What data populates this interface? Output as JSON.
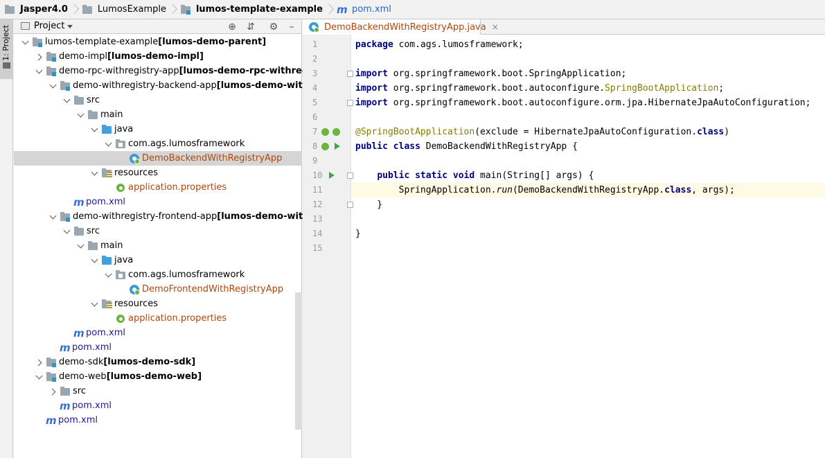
{
  "breadcrumb": [
    {
      "label": "Jasper4.0",
      "bold": true,
      "icon": "folder-icon"
    },
    {
      "label": "LumosExample",
      "bold": false,
      "icon": "folder-icon"
    },
    {
      "label": "lumos-template-example",
      "bold": true,
      "icon": "module-folder-icon"
    },
    {
      "label": "pom.xml",
      "bold": false,
      "icon": "maven-icon"
    }
  ],
  "side_strip": {
    "tab_label": "1: Project"
  },
  "project_panel": {
    "title": "Project",
    "tree": [
      {
        "depth": 0,
        "arrow": "down",
        "icon": "module",
        "name": "lumos-template-example",
        "suffix": " [lumos-demo-parent]"
      },
      {
        "depth": 1,
        "arrow": "right",
        "icon": "module",
        "name": "demo-impl",
        "suffix": " [lumos-demo-impl]"
      },
      {
        "depth": 1,
        "arrow": "down",
        "icon": "module",
        "name": "demo-rpc-withregistry-app",
        "suffix": " [lumos-demo-rpc-withregistry-"
      },
      {
        "depth": 2,
        "arrow": "down",
        "icon": "module",
        "name": "demo-withregistry-backend-app",
        "suffix": " [lumos-demo-withregi"
      },
      {
        "depth": 3,
        "arrow": "down",
        "icon": "folder",
        "name": "src",
        "suffix": ""
      },
      {
        "depth": 4,
        "arrow": "down",
        "icon": "folder",
        "name": "main",
        "suffix": ""
      },
      {
        "depth": 5,
        "arrow": "down",
        "icon": "java",
        "name": "java",
        "suffix": ""
      },
      {
        "depth": 6,
        "arrow": "down",
        "icon": "package",
        "name": "com.ags.lumosframework",
        "suffix": ""
      },
      {
        "depth": 7,
        "arrow": "none",
        "icon": "class",
        "name": "DemoBackendWithRegistryApp",
        "suffix": "",
        "selected": true
      },
      {
        "depth": 5,
        "arrow": "down",
        "icon": "resources",
        "name": "resources",
        "suffix": ""
      },
      {
        "depth": 6,
        "arrow": "none",
        "icon": "properties",
        "name": "application.properties",
        "suffix": ""
      },
      {
        "depth": 3,
        "arrow": "none",
        "icon": "maven",
        "name": "pom.xml",
        "suffix": ""
      },
      {
        "depth": 2,
        "arrow": "down",
        "icon": "module",
        "name": "demo-withregistry-frontend-app",
        "suffix": " [lumos-demo-withregi"
      },
      {
        "depth": 3,
        "arrow": "down",
        "icon": "folder",
        "name": "src",
        "suffix": ""
      },
      {
        "depth": 4,
        "arrow": "down",
        "icon": "folder",
        "name": "main",
        "suffix": ""
      },
      {
        "depth": 5,
        "arrow": "down",
        "icon": "java",
        "name": "java",
        "suffix": ""
      },
      {
        "depth": 6,
        "arrow": "down",
        "icon": "package",
        "name": "com.ags.lumosframework",
        "suffix": ""
      },
      {
        "depth": 7,
        "arrow": "none",
        "icon": "class",
        "name": "DemoFrontendWithRegistryApp",
        "suffix": ""
      },
      {
        "depth": 5,
        "arrow": "down",
        "icon": "resources",
        "name": "resources",
        "suffix": ""
      },
      {
        "depth": 6,
        "arrow": "none",
        "icon": "properties",
        "name": "application.properties",
        "suffix": ""
      },
      {
        "depth": 3,
        "arrow": "none",
        "icon": "maven",
        "name": "pom.xml",
        "suffix": ""
      },
      {
        "depth": 2,
        "arrow": "none",
        "icon": "maven",
        "name": "pom.xml",
        "suffix": ""
      },
      {
        "depth": 1,
        "arrow": "right",
        "icon": "module",
        "name": "demo-sdk",
        "suffix": " [lumos-demo-sdk]"
      },
      {
        "depth": 1,
        "arrow": "down",
        "icon": "module",
        "name": "demo-web",
        "suffix": " [lumos-demo-web]"
      },
      {
        "depth": 2,
        "arrow": "right",
        "icon": "folder",
        "name": "src",
        "suffix": ""
      },
      {
        "depth": 2,
        "arrow": "none",
        "icon": "maven",
        "name": "pom.xml",
        "suffix": ""
      },
      {
        "depth": 1,
        "arrow": "none",
        "icon": "maven",
        "name": "pom.xml",
        "suffix": ""
      }
    ]
  },
  "editor": {
    "tab_label": "DemoBackendWithRegistryApp.java",
    "tab_close": "×",
    "current_line": 11,
    "lines": [
      [
        {
          "t": "package",
          "c": "kw"
        },
        {
          "t": " com.ags.lumosframework;"
        }
      ],
      [],
      [
        {
          "t": "import",
          "c": "kw"
        },
        {
          "t": " org.springframework.boot.SpringApplication;"
        }
      ],
      [
        {
          "t": "import",
          "c": "kw"
        },
        {
          "t": " org.springframework.boot.autoconfigure."
        },
        {
          "t": "SpringBootApplication",
          "c": "ann"
        },
        {
          "t": ";"
        }
      ],
      [
        {
          "t": "import",
          "c": "kw"
        },
        {
          "t": " org.springframework.boot.autoconfigure.orm.jpa.HibernateJpaAutoConfiguration;"
        }
      ],
      [],
      [
        {
          "t": "@SpringBootApplication",
          "c": "ann"
        },
        {
          "t": "(exclude = HibernateJpaAutoConfiguration."
        },
        {
          "t": "class",
          "c": "kw"
        },
        {
          "t": ")"
        }
      ],
      [
        {
          "t": "public class",
          "c": "kw"
        },
        {
          "t": " DemoBackendWithRegistryApp {"
        }
      ],
      [],
      [
        {
          "t": "    "
        },
        {
          "t": "public static void",
          "c": "kw"
        },
        {
          "t": " main(String[] args) {"
        }
      ],
      [
        {
          "t": "        SpringApplication."
        },
        {
          "t": "run",
          "c": "it"
        },
        {
          "t": "(DemoBackendWithRegistryApp."
        },
        {
          "t": "class",
          "c": "kw"
        },
        {
          "t": ", args);"
        }
      ],
      [
        {
          "t": "    }"
        }
      ],
      [],
      [
        {
          "t": "}"
        }
      ],
      []
    ]
  },
  "colors": {
    "keyword": "#000080",
    "annotation": "#808000",
    "class_name": "#b0470b",
    "current_line": "#fffae3"
  }
}
